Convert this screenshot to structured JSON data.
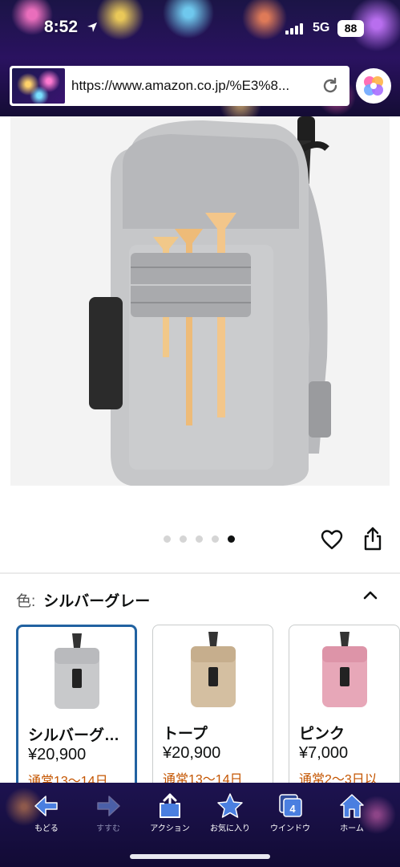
{
  "status_bar": {
    "time": "8:52",
    "network": "5G",
    "battery": "88"
  },
  "browser": {
    "url": "https://www.amazon.co.jp/%E3%8..."
  },
  "product": {
    "carousel": {
      "count": 5,
      "active_index": 4
    },
    "color_label": "色:",
    "color_value": "シルバーグレー"
  },
  "variants": [
    {
      "name": "シルバーグ…",
      "price": "¥20,900",
      "delivery": "通常13〜14日",
      "color": "#c8c9cb",
      "selected": true
    },
    {
      "name": "トープ",
      "price": "¥20,900",
      "delivery": "通常13〜14日",
      "color": "#d4bfa1",
      "selected": false
    },
    {
      "name": "ピンク",
      "price": "¥7,000",
      "delivery": "通常2〜3日以",
      "color": "#e7a7b8",
      "selected": false
    }
  ],
  "toolbar": {
    "back": "もどる",
    "forward": "すすむ",
    "action": "アクション",
    "favorites": "お気に入り",
    "windows": "ウインドウ",
    "windows_count": "4",
    "home": "ホーム"
  },
  "colors": {
    "accent_blue": "#2162a1",
    "delivery_orange": "#c45500",
    "toolbar_icon": "#4a7fe0"
  }
}
